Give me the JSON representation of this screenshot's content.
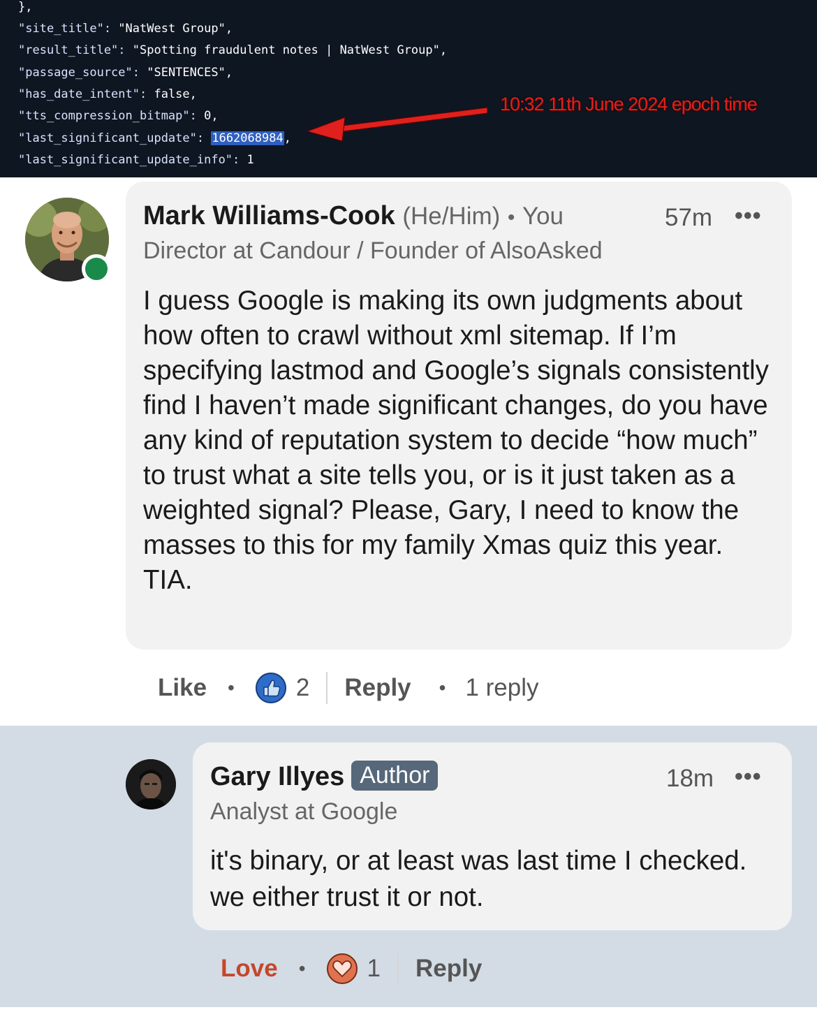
{
  "code": {
    "lines": [
      {
        "text": "},"
      },
      {
        "key": "\"site_title\": ",
        "value": "\"NatWest Group\","
      },
      {
        "key": "\"result_title\": ",
        "value": "\"Spotting fraudulent notes | NatWest Group\","
      },
      {
        "key": "\"passage_source\": ",
        "value": "\"SENTENCES\","
      },
      {
        "key": "\"has_date_intent\": ",
        "value": "false,"
      },
      {
        "key": "\"tts_compression_bitmap\": ",
        "value": "0,"
      },
      {
        "key": "\"last_significant_update\": ",
        "value": "1662068984",
        "suffix": ","
      },
      {
        "key": "\"last_significant_update_info\": ",
        "value": "1"
      }
    ],
    "annotation": "10:32 11th June 2024 epoch time"
  },
  "comment": {
    "author": "Mark Williams-Cook",
    "pronouns": "(He/Him)",
    "separator": "•",
    "you_label": "You",
    "time": "57m",
    "more": "•••",
    "headline": "Director at Candour / Founder of AlsoAsked",
    "body": "I guess Google is making its own judgments about how often to crawl without xml sitemap. If I’m specifying lastmod and Google’s signals consistently find I haven’t made significant changes, do you have any kind of reputation system to decide “how much” to trust what a site tells you, or is it just taken as a weighted signal? Please, Gary, I need to know the masses to this for my family Xmas quiz this year. TIA.",
    "like_label": "Like",
    "reaction_count": "2",
    "reply_label": "Reply",
    "replies_label": "1 reply"
  },
  "reply": {
    "author": "Gary Illyes",
    "badge": "Author",
    "time": "18m",
    "more": "•••",
    "headline": "Analyst at Google",
    "body": "it's binary, or at least was last time I checked. we either trust it or not.",
    "love_label": "Love",
    "reaction_count": "1",
    "reply_label": "Reply"
  },
  "colors": {
    "like_blue": "#2d6cc9",
    "love_red": "#c4472c",
    "presence_green": "#1a8a4a",
    "badge_gray": "#56687a",
    "highlight_blue": "#2f5fbf",
    "annotation_red": "#e0201c"
  },
  "icons": [
    "thumbs-up-icon",
    "heart-icon",
    "more-icon",
    "arrow-annotation"
  ]
}
